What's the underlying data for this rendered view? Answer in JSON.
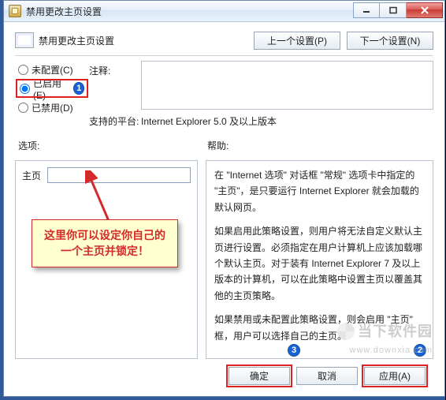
{
  "window": {
    "title": "禁用更改主页设置",
    "controls": {
      "min": "—",
      "max": "▭",
      "close": "✕"
    }
  },
  "header": {
    "label": "禁用更改主页设置",
    "prev": "上一个设置(P)",
    "next": "下一个设置(N)"
  },
  "radios": {
    "unconfigured": "未配置(C)",
    "enabled": "已启用(E)",
    "disabled": "已禁用(D)",
    "selected": "enabled"
  },
  "labels": {
    "notes": "注释:",
    "platforms": "支持的平台:",
    "platforms_value": "Internet Explorer 5.0 及以上版本",
    "options": "选项:",
    "help": "帮助:"
  },
  "homepage": {
    "label": "主页",
    "value": ""
  },
  "callout": {
    "line1": "这里你可以设定你自己的",
    "line2": "一个主页并锁定！"
  },
  "help_text": {
    "p1": "在 \"Internet 选项\" 对话框 \"常规\" 选项卡中指定的 \"主页\"，是只要运行 Internet Explorer 就会加载的默认网页。",
    "p2": "如果启用此策略设置，则用户将无法自定义默认主页进行设置。必须指定在用户计算机上应该加载哪个默认主页。对于装有 Internet Explorer 7 及以上版本的计算机，可以在此策略中设置主页以覆盖其他的主页策略。",
    "p3": "如果禁用或未配置此策略设置，则会启用 \"主页\" 框，用户可以选择自己的主页。"
  },
  "buttons": {
    "ok": "确定",
    "cancel": "取消",
    "apply": "应用(A)"
  },
  "badges": {
    "b1": "1",
    "b2": "2",
    "b3": "3"
  },
  "watermark": "当下软件园",
  "watermark_url": "www.downxia.com"
}
